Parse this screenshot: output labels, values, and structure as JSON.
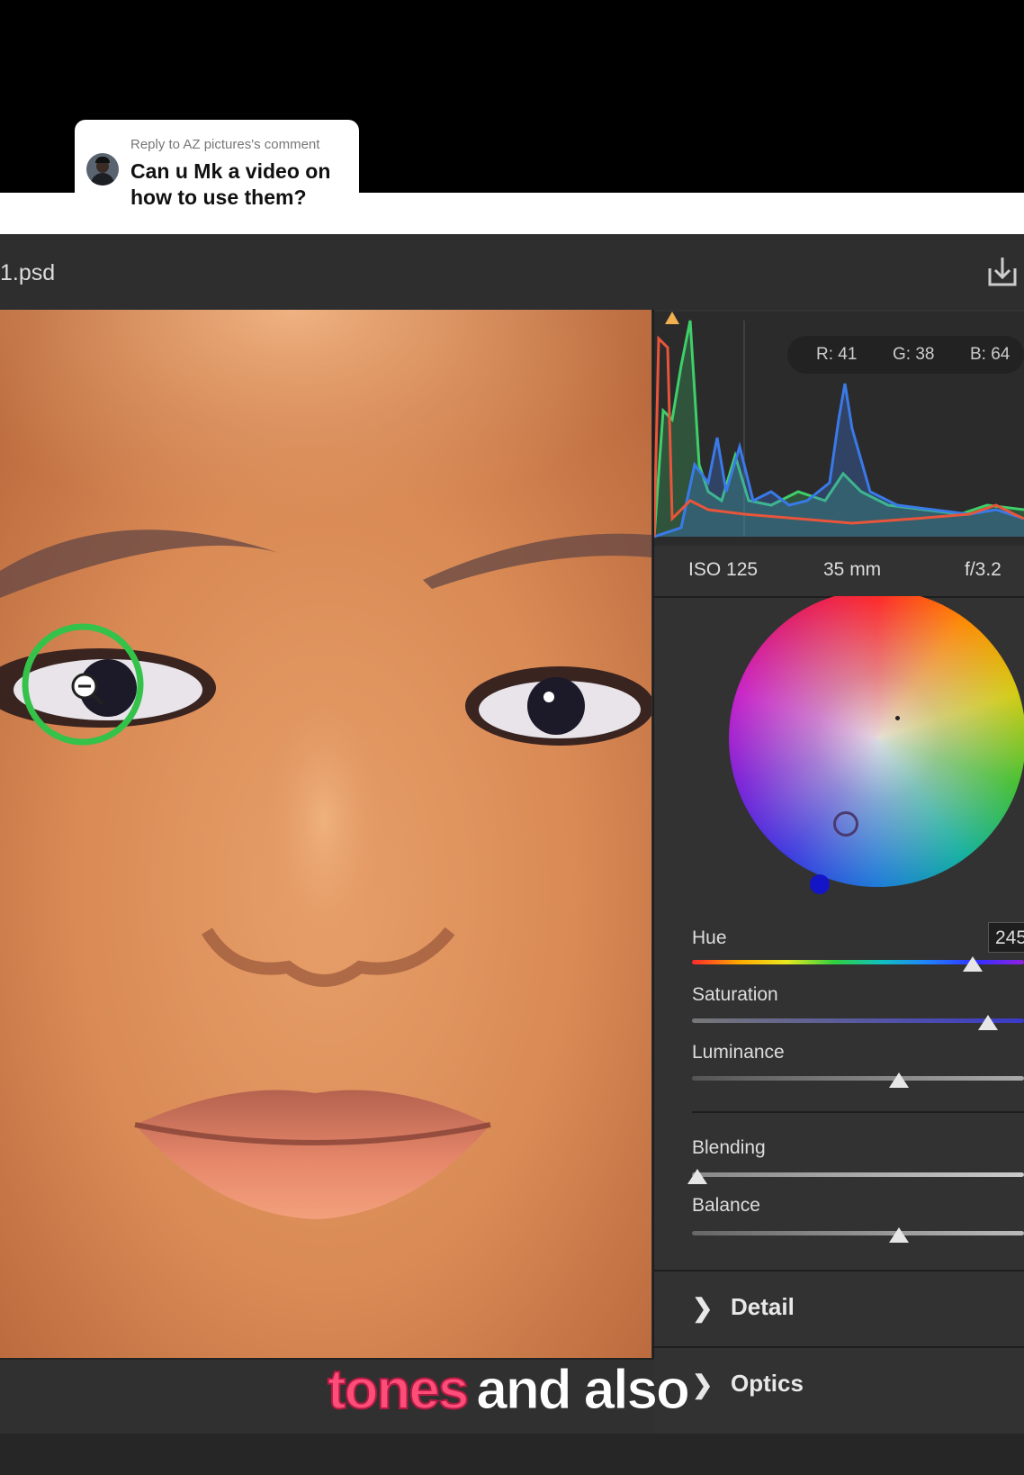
{
  "comment": {
    "reply_label": "Reply to AZ pictures's comment",
    "text": "Can u Mk a video on how to use them?"
  },
  "document": {
    "title": "1.psd",
    "save_icon": "export-icon"
  },
  "histogram": {
    "readout": {
      "r": "R: 41",
      "g": "G: 38",
      "b": "B: 64"
    },
    "colors": {
      "red": "#e8553a",
      "green": "#3fcf6a",
      "blue": "#3a7ae8"
    }
  },
  "exif": {
    "iso": "ISO 125",
    "focal": "35 mm",
    "aperture": "f/3.2"
  },
  "color_grading": {
    "hue": {
      "label": "Hue",
      "value": "245",
      "level": 0.87
    },
    "saturation": {
      "label": "Saturation",
      "level": 0.91
    },
    "luminance": {
      "label": "Luminance",
      "level": 0.66
    },
    "blending": {
      "label": "Blending",
      "level": 0.01
    },
    "balance": {
      "label": "Balance",
      "level": 0.66
    }
  },
  "sections": [
    {
      "label": "Detail",
      "icon": "chevron-right-icon"
    },
    {
      "label": "Optics",
      "icon": "chevron-right-icon"
    }
  ],
  "cursor_icon": "zoom-out-icon",
  "subtitle": {
    "highlight": "tones",
    "rest": "and also"
  }
}
